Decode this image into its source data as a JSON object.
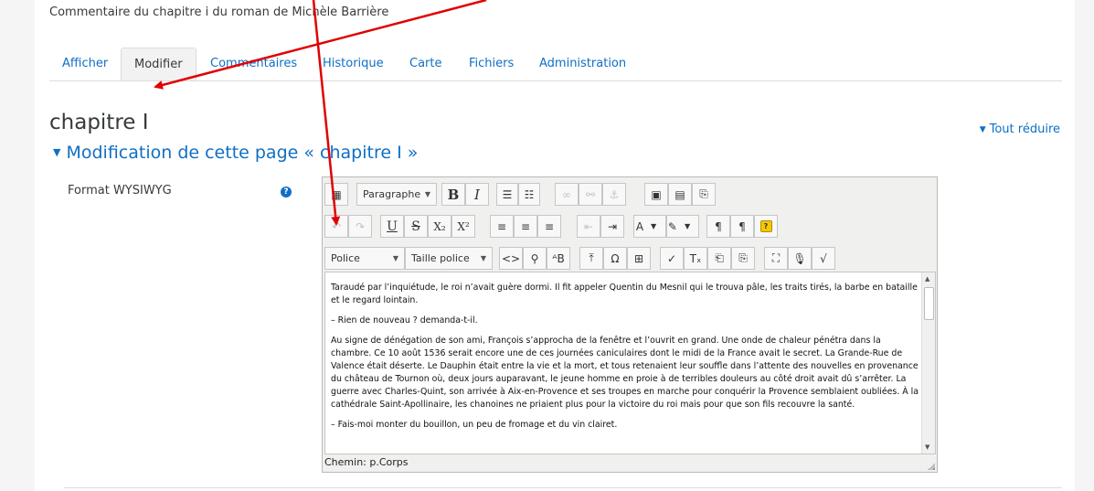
{
  "breadcrumb": "Commentaire du chapitre i du roman de Michèle Barrière",
  "tabs": [
    {
      "label": "Afficher",
      "active": false
    },
    {
      "label": "Modifier",
      "active": true
    },
    {
      "label": "Commentaires",
      "active": false
    },
    {
      "label": "Historique",
      "active": false
    },
    {
      "label": "Carte",
      "active": false
    },
    {
      "label": "Fichiers",
      "active": false
    },
    {
      "label": "Administration",
      "active": false
    }
  ],
  "page_title": "chapitre I",
  "collapse_all": "Tout réduire",
  "section_header": "Modification de cette page « chapitre I »",
  "field_label": "Format WYSIWYG",
  "editor": {
    "format_select": "Paragraphe",
    "font_select": "Police",
    "size_select": "Taille police",
    "paragraphs": [
      "Taraudé par l’inquiétude, le roi n’avait guère dormi. Il fit appeler Quentin du Mesnil qui le trouva pâle, les traits tirés, la barbe en bataille et le regard lointain.",
      "– Rien de nouveau ? demanda-t-il.",
      "Au signe de dénégation de son ami, François s’approcha de la fenêtre et l’ouvrit en grand. Une onde de chaleur pénétra dans la chambre. Ce 10 août 1536 serait encore une de ces journées caniculaires dont le midi de la France avait le secret. La Grande-Rue de Valence était déserte. Le Dauphin était entre la vie et la mort, et tous retenaient leur souffle dans l’attente des nouvelles en provenance du château de Tournon où, deux jours auparavant, le jeune homme en proie à de terribles douleurs au côté droit avait dû s’arrêter. La guerre avec Charles-Quint, son arrivée à Aix-en-Provence et ses troupes en marche pour conquérir la Provence semblaient oubliées. À la cathédrale Saint-Apollinaire, les chanoines ne priaient plus pour la victoire du roi mais pour que son fils recouvre la santé.",
      "– Fais-moi monter du bouillon, un peu de fromage et du vin clairet."
    ],
    "status_path": "Chemin: p.Corps"
  },
  "colors": {
    "link": "#0f6fc5",
    "annotation_arrow": "#e00000"
  }
}
